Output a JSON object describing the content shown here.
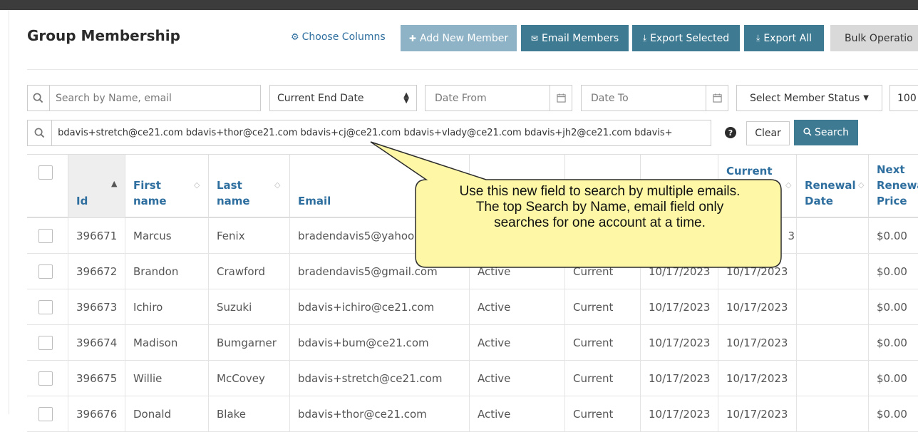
{
  "header": {
    "title": "Group Membership",
    "choose_columns": "Choose Columns",
    "add_new_member": "Add New Member",
    "email_members": "Email Members",
    "export_selected": "Export Selected",
    "export_all": "Export All",
    "bulk_operations": "Bulk Operatio"
  },
  "filters": {
    "search_placeholder": "Search by Name, email",
    "date_type": "Current End Date",
    "date_from_placeholder": "Date From",
    "date_to_placeholder": "Date To",
    "member_status": "Select Member Status",
    "page_size": "100",
    "multi_email_value": "bdavis+stretch@ce21.com bdavis+thor@ce21.com bdavis+cj@ce21.com bdavis+vlady@ce21.com bdavis+jh2@ce21.com bdavis+",
    "help": "?",
    "clear": "Clear",
    "search": "Search"
  },
  "callout": {
    "line1": "Use this new field to search by multiple emails.",
    "line2": "The top Search by Name, email field only",
    "line3": "searches for one account at a time."
  },
  "table": {
    "headers": {
      "id": "Id",
      "first_name_1": "First",
      "first_name_2": "name",
      "last_name_1": "Last",
      "last_name_2": "name",
      "email": "Email",
      "current_end_1": "Current",
      "renewal_1": "Renewal",
      "renewal_2": "Date",
      "next_price_1": "Next",
      "next_price_2": "Renewa",
      "next_price_3": "Price"
    },
    "rows": [
      {
        "id": "396671",
        "first": "Marcus",
        "last": "Fenix",
        "email": "bradendavis5@yahoo.",
        "status": "",
        "membership": "",
        "start": "",
        "end": "3",
        "renewal": "",
        "price": "$0.00"
      },
      {
        "id": "396672",
        "first": "Brandon",
        "last": "Crawford",
        "email": "bradendavis5@gmail.com",
        "status": "Active",
        "membership": "Current",
        "start": "10/17/2023",
        "end": "10/17/2023",
        "renewal": "",
        "price": "$0.00"
      },
      {
        "id": "396673",
        "first": "Ichiro",
        "last": "Suzuki",
        "email": "bdavis+ichiro@ce21.com",
        "status": "Active",
        "membership": "Current",
        "start": "10/17/2023",
        "end": "10/17/2023",
        "renewal": "",
        "price": "$0.00"
      },
      {
        "id": "396674",
        "first": "Madison",
        "last": "Bumgarner",
        "email": "bdavis+bum@ce21.com",
        "status": "Active",
        "membership": "Current",
        "start": "10/17/2023",
        "end": "10/17/2023",
        "renewal": "",
        "price": "$0.00"
      },
      {
        "id": "396675",
        "first": "Willie",
        "last": "McCovey",
        "email": "bdavis+stretch@ce21.com",
        "status": "Active",
        "membership": "Current",
        "start": "10/17/2023",
        "end": "10/17/2023",
        "renewal": "",
        "price": "$0.00"
      },
      {
        "id": "396676",
        "first": "Donald",
        "last": "Blake",
        "email": "bdavis+thor@ce21.com",
        "status": "Active",
        "membership": "Current",
        "start": "10/17/2023",
        "end": "10/17/2023",
        "renewal": "",
        "price": "$0.00"
      }
    ]
  },
  "colors": {
    "primary_button": "#3e7a92",
    "disabled_button": "#8fb3c6",
    "link": "#2f6f9f",
    "callout_fill": "#fdf7a6",
    "callout_border": "#2b2b2b"
  }
}
